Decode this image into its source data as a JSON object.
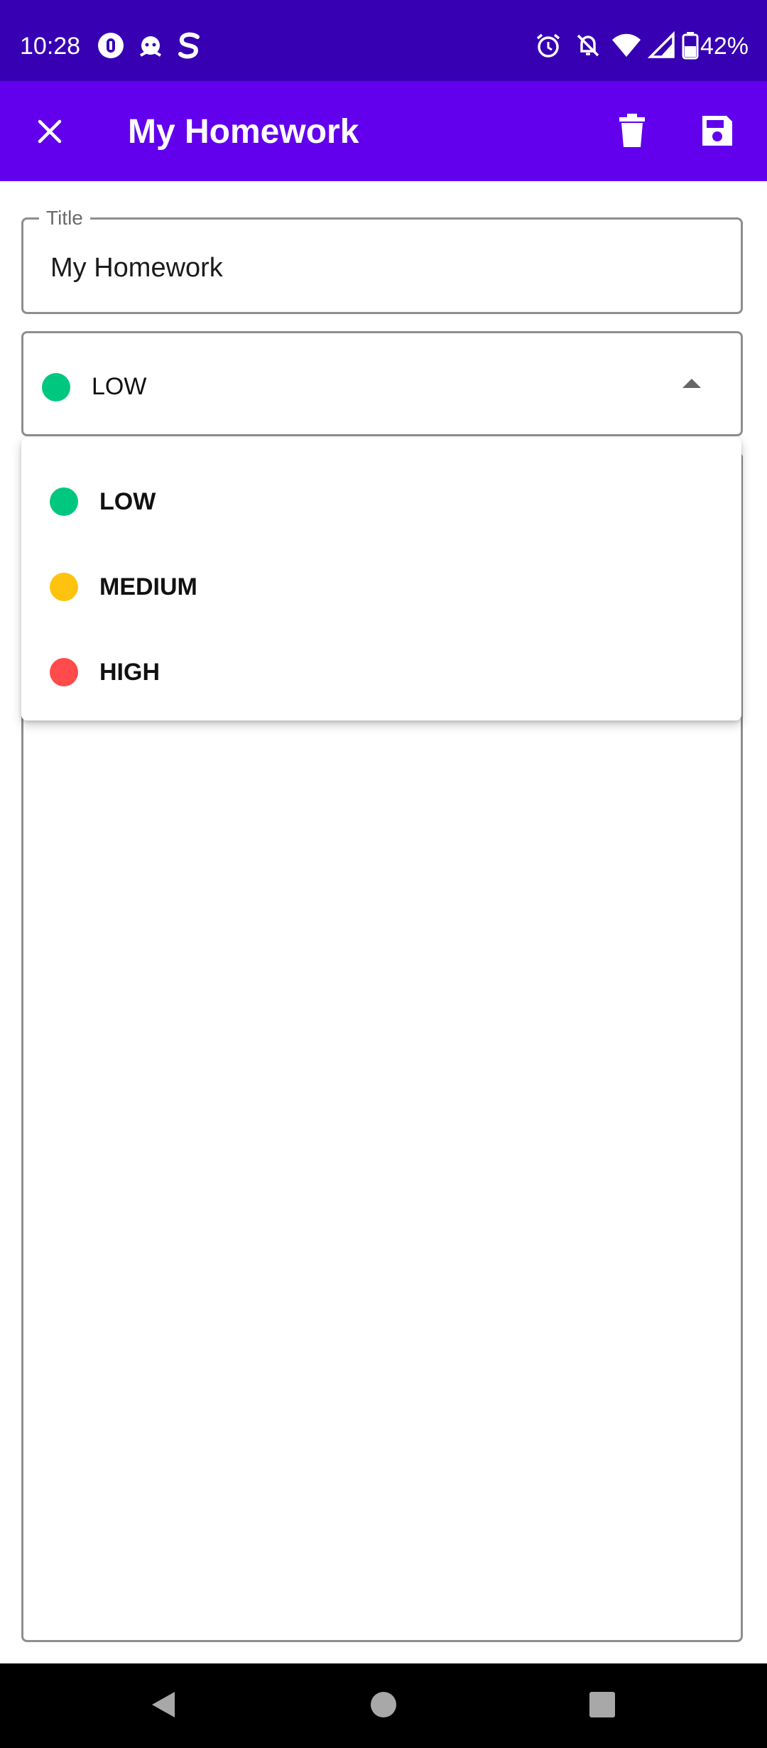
{
  "status_bar": {
    "time": "10:28",
    "battery": "42%",
    "icons": [
      "app-notification-icon",
      "cat-notification-icon",
      "s-app-icon",
      "alarm-icon",
      "notifications-off-icon",
      "wifi-icon",
      "signal-icon",
      "battery-icon"
    ]
  },
  "app_bar": {
    "title": "My Homework",
    "close_icon": "close-icon",
    "delete_icon": "trash-icon",
    "save_icon": "save-icon"
  },
  "title_field": {
    "label": "Title",
    "value": "My Homework"
  },
  "priority_select": {
    "selected_label": "LOW",
    "selected_color": "#00c77f"
  },
  "dropdown": {
    "options": [
      {
        "label": "LOW",
        "color": "#00c77f"
      },
      {
        "label": "MEDIUM",
        "color": "#ffc20e"
      },
      {
        "label": "HIGH",
        "color": "#ff4b4b"
      }
    ]
  },
  "nav_bar": {
    "back_icon": "back-icon",
    "home_icon": "home-icon",
    "recents_icon": "recents-icon"
  },
  "colors": {
    "status_bar": "#3700b3",
    "app_bar": "#6200ee"
  }
}
